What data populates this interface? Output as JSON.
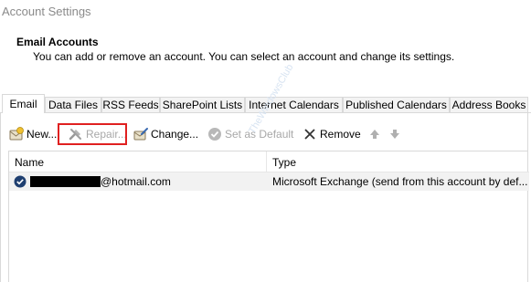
{
  "window": {
    "title": "Account Settings"
  },
  "header": {
    "title": "Email Accounts",
    "description": "You can add or remove an account. You can select an account and change its settings."
  },
  "tabs": [
    {
      "label": "Email",
      "active": true
    },
    {
      "label": "Data Files",
      "active": false
    },
    {
      "label": "RSS Feeds",
      "active": false
    },
    {
      "label": "SharePoint Lists",
      "active": false
    },
    {
      "label": "Internet Calendars",
      "active": false
    },
    {
      "label": "Published Calendars",
      "active": false
    },
    {
      "label": "Address Books",
      "active": false
    }
  ],
  "toolbar": {
    "new_label": "New...",
    "repair_label": "Repair...",
    "change_label": "Change...",
    "set_default_label": "Set as Default",
    "remove_label": "Remove"
  },
  "table": {
    "columns": [
      "Name",
      "Type"
    ],
    "rows": [
      {
        "name_suffix": "@hotmail.com",
        "type": "Microsoft Exchange (send from this account by def..."
      }
    ]
  },
  "watermark": "TheWindowsClub",
  "colors": {
    "highlight": "#e02020",
    "selected_row": "#f2f2f2",
    "default_check": "#1f3f70"
  }
}
